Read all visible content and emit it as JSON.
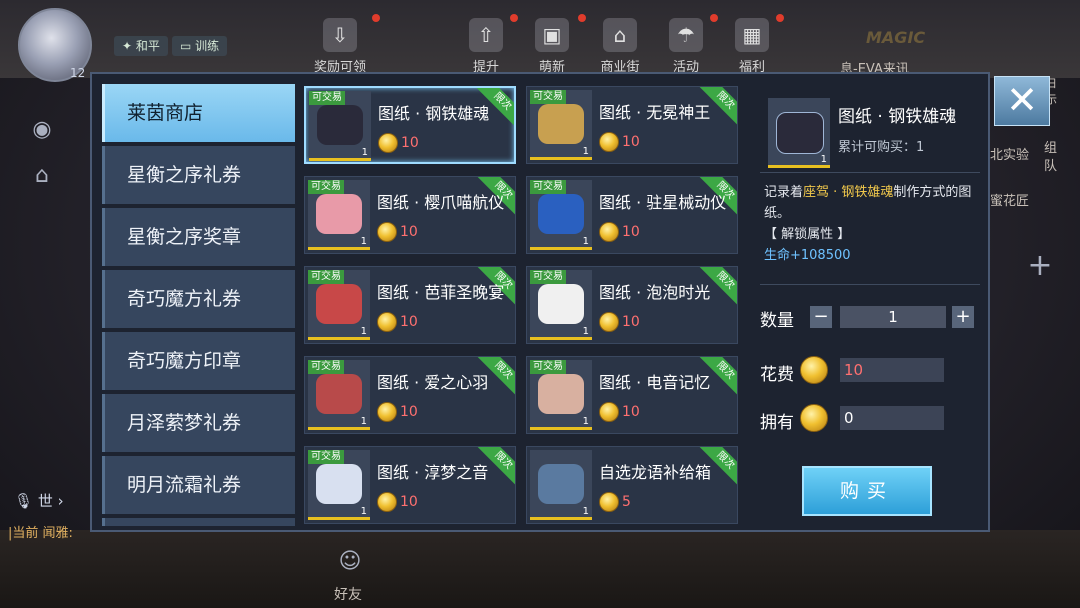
{
  "hud": {
    "level": "12",
    "mode_peace": "和平",
    "mode_train": "训练",
    "top_icons": [
      {
        "label": "奖励可领",
        "icon": "download-icon"
      },
      {
        "label": "提升",
        "icon": "upgrade-icon"
      },
      {
        "label": "萌新",
        "icon": "gift-icon"
      },
      {
        "label": "商业街",
        "icon": "shop-icon"
      },
      {
        "label": "活动",
        "icon": "balloon-icon"
      },
      {
        "label": "福利",
        "icon": "treasure-icon"
      }
    ],
    "bg_event": "息-EVA来讯",
    "bg_magic": "MAGIC",
    "bg_right_1": "北实验",
    "bg_right_2": "组队",
    "bg_right_3": "蜜花匠",
    "bg_right_4": "日示",
    "chat_channel": "世",
    "chat_line": "|当前  闻雅:",
    "bottom_friend": "好友"
  },
  "shop": {
    "tabs": [
      "莱茵商店",
      "星衡之序礼券",
      "星衡之序奖章",
      "奇巧魔方礼券",
      "奇巧魔方印章",
      "月泽萦梦礼券",
      "明月流霜礼券"
    ],
    "active_tab": 0,
    "items": [
      {
        "name": "图纸 · 钢铁雄魂",
        "price": "10",
        "qty": "1",
        "tradable": "可交易",
        "ribbon": "限次",
        "art": "#2a2a3a"
      },
      {
        "name": "图纸 · 无冕神王",
        "price": "10",
        "qty": "1",
        "tradable": "可交易",
        "ribbon": "限次",
        "art": "#c8a050"
      },
      {
        "name": "图纸 · 樱爪喵航仪",
        "price": "10",
        "qty": "1",
        "tradable": "可交易",
        "ribbon": "限次",
        "art": "#e89aa8"
      },
      {
        "name": "图纸 · 驻星械动仪",
        "price": "10",
        "qty": "1",
        "tradable": "可交易",
        "ribbon": "限次",
        "art": "#2a60c0"
      },
      {
        "name": "图纸 · 芭菲圣晚宴",
        "price": "10",
        "qty": "1",
        "tradable": "可交易",
        "ribbon": "限次",
        "art": "#c84848"
      },
      {
        "name": "图纸 · 泡泡时光",
        "price": "10",
        "qty": "1",
        "tradable": "可交易",
        "ribbon": "限次",
        "art": "#f0f0f0"
      },
      {
        "name": "图纸 · 爱之心羽",
        "price": "10",
        "qty": "1",
        "tradable": "可交易",
        "ribbon": "限次",
        "art": "#b84a4a"
      },
      {
        "name": "图纸 · 电音记忆",
        "price": "10",
        "qty": "1",
        "tradable": "可交易",
        "ribbon": "限次",
        "art": "#d8b0a0"
      },
      {
        "name": "图纸 · 淳梦之音",
        "price": "10",
        "qty": "1",
        "tradable": "可交易",
        "ribbon": "限次",
        "art": "#d8e0f0"
      },
      {
        "name": "自选龙语补给箱",
        "price": "5",
        "qty": "1",
        "tradable": "",
        "ribbon": "限次",
        "art": "#5a7aa0"
      }
    ],
    "selected_item": 0
  },
  "detail": {
    "name": "图纸 · 钢铁雄魂",
    "limit_text": "累计可购买：1",
    "desc_pre": "记录着",
    "desc_hl1": "座驾 · 钢铁雄魂",
    "desc_post": "制作方式的图纸。",
    "unlock_label": "【 解锁属性 】",
    "attr": "生命+108500",
    "qty_label": "数量",
    "qty_value": "1",
    "cost_label": "花费",
    "cost_value": "10",
    "own_label": "拥有",
    "own_value": "0",
    "buy_label": "购买",
    "thumb_qty": "1"
  },
  "colors": {
    "accent": "#6ab9ea",
    "price": "#ff7070",
    "highlight": "#f2c94c",
    "attr": "#6fc2ff"
  }
}
